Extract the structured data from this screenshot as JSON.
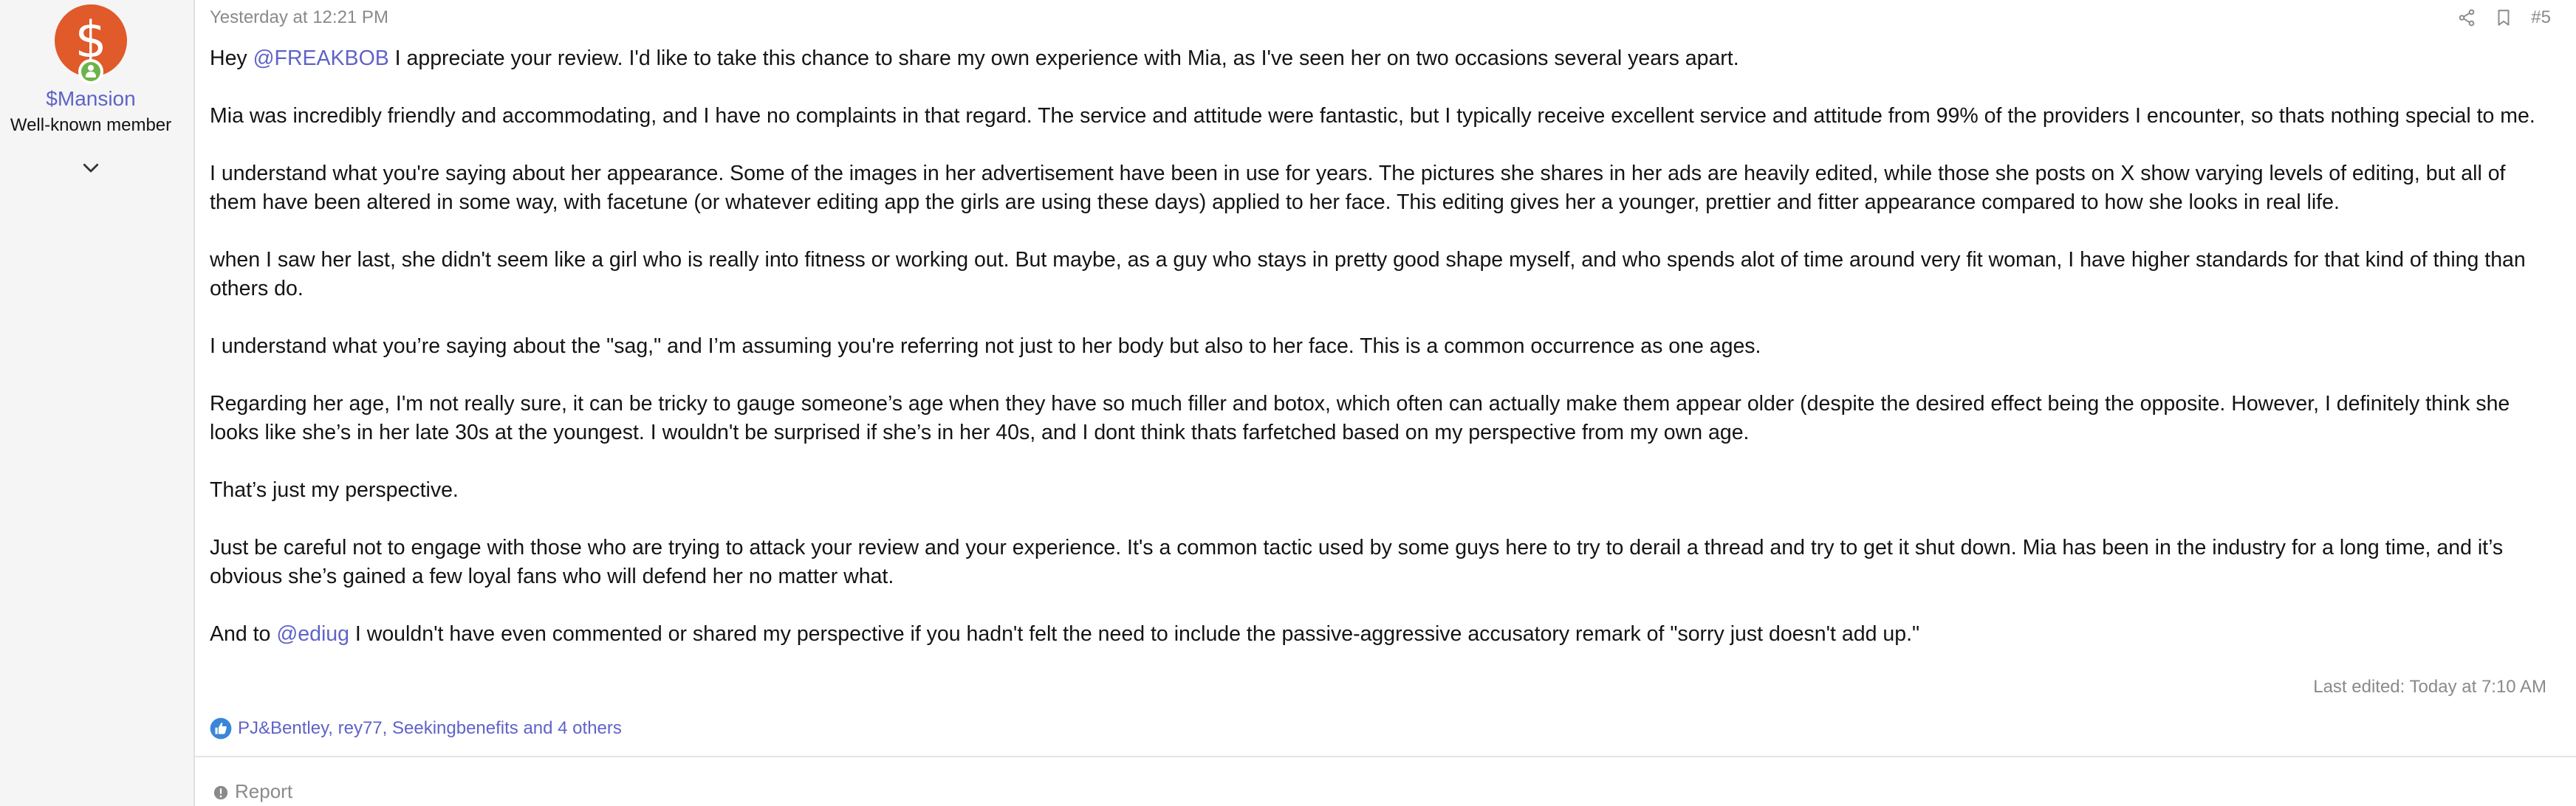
{
  "user": {
    "avatar_letter": "$",
    "name": "$Mansion",
    "title": "Well-known member",
    "avatar_color": "#e05a2a",
    "online_color": "#6db34c"
  },
  "post": {
    "date": "Yesterday at 12:21 PM",
    "number": "#5",
    "paragraphs": [
      {
        "pre": "Hey ",
        "mention": "@FREAKBOB",
        "post": " I appreciate your review. I'd like to take this chance to share my own experience with Mia, as I've seen her on two occasions several years apart."
      },
      {
        "text": "Mia was incredibly friendly and accommodating, and I have no complaints in that regard. The service and attitude were fantastic, but I typically receive excellent service and attitude from 99% of the providers I encounter, so thats nothing special to me."
      },
      {
        "text": "I understand what you're saying about her appearance. Some of the images in her advertisement have been in use for years. The pictures she shares in her ads are heavily edited, while those she posts on X show varying levels of editing, but all of them have been altered in some way, with facetune (or whatever editing app the girls are using these days) applied to her face. This editing gives her a younger, prettier and fitter appearance compared to how she looks in real life."
      },
      {
        "text": "when I saw her last, she didn't seem like a girl who is really into fitness or working out. But maybe, as a guy who stays in pretty good shape myself, and who spends alot of time around very fit woman, I have higher standards for that kind of thing than others do."
      },
      {
        "text": "I understand what you’re saying about the \"sag,\" and I’m assuming you're referring not just to her body but also to her face. This is a common occurrence as one ages."
      },
      {
        "text": "Regarding her age, I'm not really sure, it can be tricky to gauge someone’s age when they have so much filler and botox, which often can actually make them appear older (despite the desired effect being the opposite. However, I definitely think she looks like she’s in her late 30s at the youngest. I wouldn't be surprised if she’s in her 40s, and I dont think thats farfetched based on my perspective from my own age."
      },
      {
        "text": "That’s just my perspective."
      },
      {
        "text": "Just be careful not to engage with those who are trying to attack your review and your experience. It's a common tactic used by some guys here to try to derail a thread and try to get it shut down. Mia has been in the industry for a long time, and it’s obvious she’s gained a few loyal fans who will defend her no matter what."
      },
      {
        "pre": "And to ",
        "mention": "@ediug",
        "post": " I wouldn't have even commented or shared my perspective if you hadn't felt the need to include the passive-aggressive accusatory remark of \"sorry just doesn't add up.\""
      }
    ],
    "last_edited": "Last edited: Today at 7:10 AM",
    "reactions": "PJ&Bentley, rey77, Seekingbenefits and 4 others",
    "report_label": "Report",
    "icons": {
      "share": "share-icon",
      "bookmark": "bookmark-icon",
      "like": "like-icon",
      "report": "report-icon",
      "expand": "chevron-down-icon"
    },
    "link_color": "#5f63c8"
  }
}
